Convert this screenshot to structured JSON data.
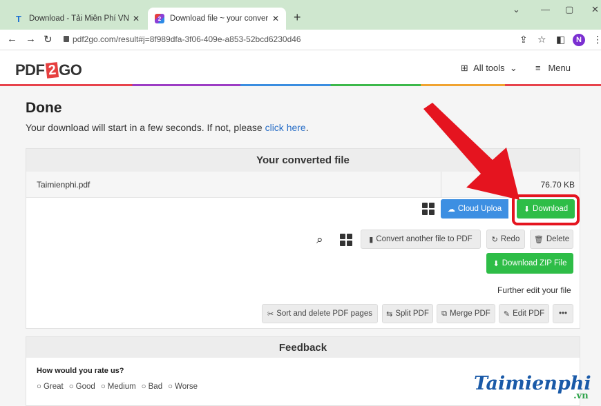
{
  "browser": {
    "tabs": [
      {
        "title": "Download - Tải Miễn Phí VN - Ph",
        "favicon": "T",
        "active": false
      },
      {
        "title": "Download file ~ your conversion",
        "favicon": "2",
        "active": true
      }
    ],
    "url": "pdf2go.com/result#j=8f989dfa-3f06-409e-a853-52bcd6230d46",
    "profile_initial": "N"
  },
  "site": {
    "logo_left": "PDF",
    "logo_mid": "2",
    "logo_right": "GO",
    "all_tools": "All tools",
    "menu": "Menu"
  },
  "page": {
    "title": "Done",
    "hint_text": "Your download will start in a few seconds. If not, please ",
    "hint_link": "click here",
    "hint_end": "."
  },
  "converted": {
    "heading": "Your converted file",
    "filename": "Taimienphi.pdf",
    "filesize": "76.70 KB",
    "cloud_upload": "Cloud Uploa",
    "download": "Download",
    "convert_another": "Convert another file to PDF",
    "redo": "Redo",
    "delete": "Delete",
    "download_zip": "Download ZIP File",
    "further_edit": "Further edit your file",
    "sort_delete": "Sort and delete PDF pages",
    "split": "Split PDF",
    "merge": "Merge PDF",
    "edit": "Edit PDF",
    "more": "•••"
  },
  "feedback": {
    "heading": "Feedback",
    "question": "How would you rate us?",
    "options": [
      "Great",
      "Good",
      "Medium",
      "Bad",
      "Worse"
    ]
  },
  "watermark": {
    "main": "Taimienphi",
    "suffix": ".vn"
  },
  "colors": {
    "green": "#2ebd47",
    "blue": "#3d8fe2",
    "highlight": "#e5141f",
    "link": "#2a6fc7"
  }
}
